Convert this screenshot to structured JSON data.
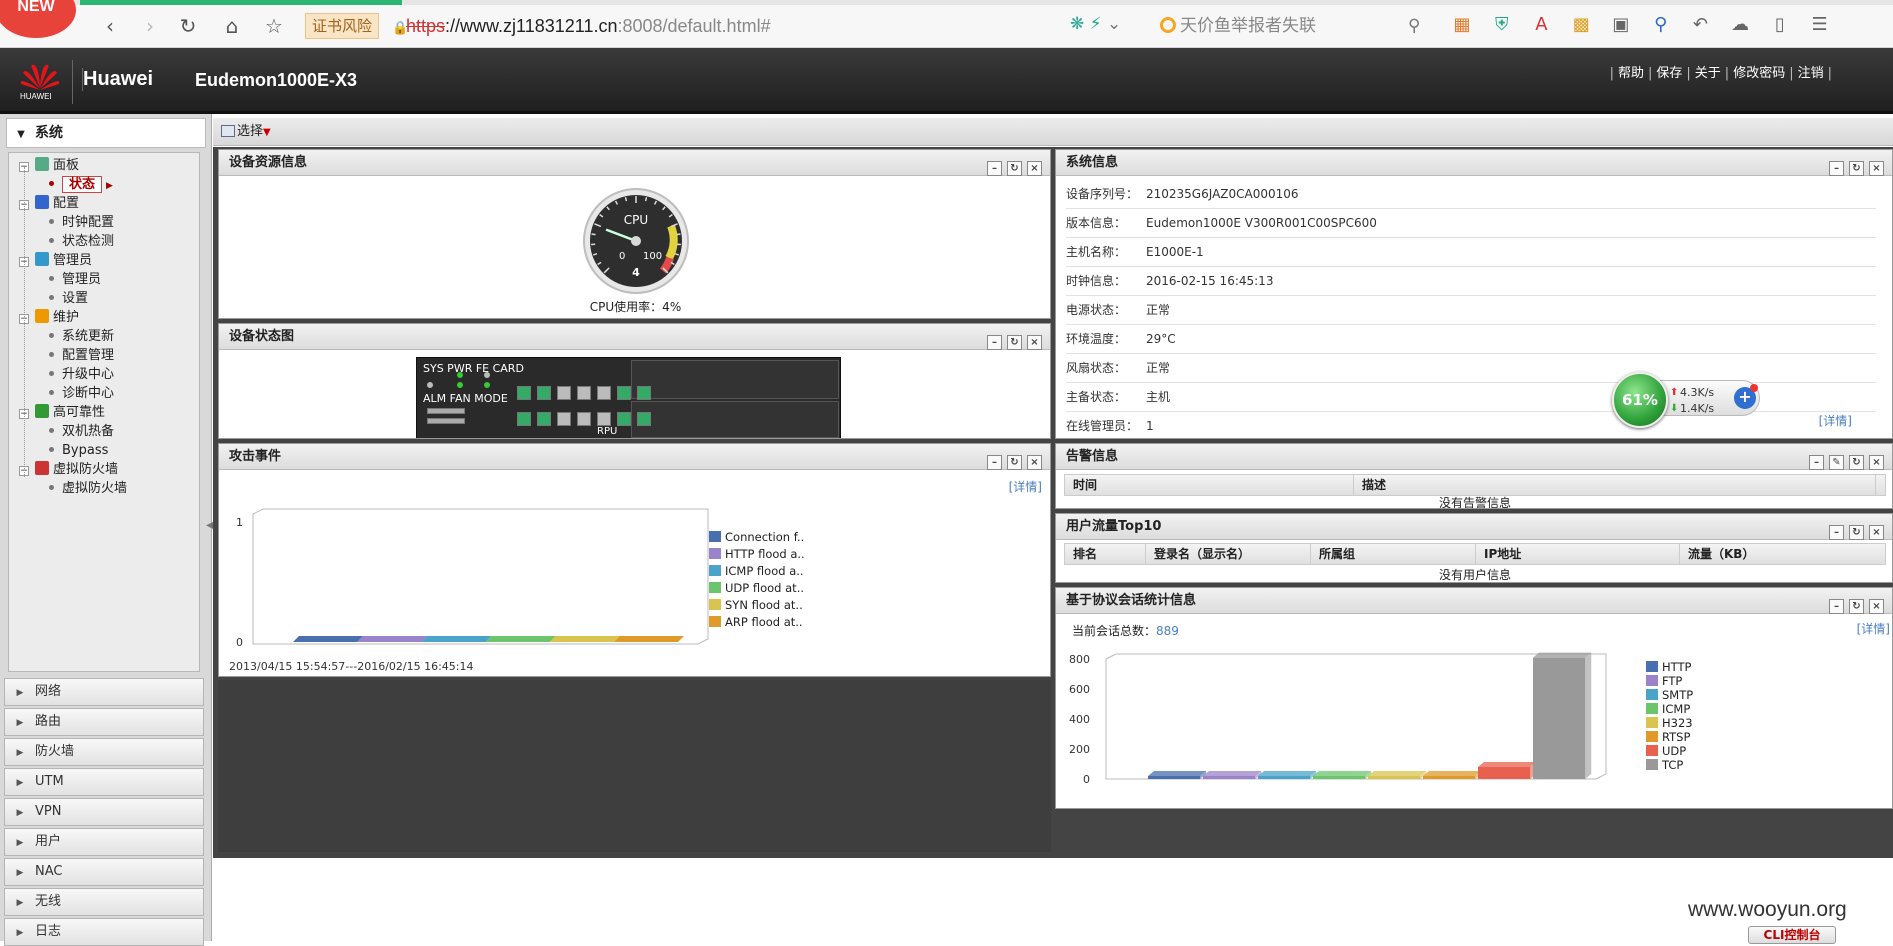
{
  "browser": {
    "new_badge": "NEW",
    "cert_warning": "证书风险",
    "url_proto": "https",
    "url_host": "://www.zj11831211.cn",
    "url_rest": ":8008/default.html#",
    "search_text": "天价鱼举报者失联",
    "load_progress_percent": 17
  },
  "header": {
    "logo_text": "HUAWEI",
    "brand": "Huawei",
    "product": "Eudemon1000E-X3",
    "links": [
      "帮助",
      "保存",
      "关于",
      "修改密码",
      "注销"
    ]
  },
  "sidebar": {
    "top_label": "系统",
    "tree": [
      {
        "label": "面板",
        "level": 0,
        "icon": "dashboard-icon"
      },
      {
        "label": "状态",
        "level": 1,
        "selected": true
      },
      {
        "label": "配置",
        "level": 0,
        "icon": "gear-icon"
      },
      {
        "label": "时钟配置",
        "level": 1
      },
      {
        "label": "状态检测",
        "level": 1
      },
      {
        "label": "管理员",
        "level": 0,
        "icon": "admin-icon"
      },
      {
        "label": "管理员",
        "level": 1
      },
      {
        "label": "设置",
        "level": 1
      },
      {
        "label": "维护",
        "level": 0,
        "icon": "maintenance-icon"
      },
      {
        "label": "系统更新",
        "level": 1
      },
      {
        "label": "配置管理",
        "level": 1
      },
      {
        "label": "升级中心",
        "level": 1
      },
      {
        "label": "诊断中心",
        "level": 1
      },
      {
        "label": "高可靠性",
        "level": 0,
        "icon": "reliability-icon"
      },
      {
        "label": "双机热备",
        "level": 1
      },
      {
        "label": "Bypass",
        "level": 1
      },
      {
        "label": "虚拟防火墙",
        "level": 0,
        "icon": "firewall-icon"
      },
      {
        "label": "虚拟防火墙",
        "level": 1
      }
    ],
    "menu": [
      "网络",
      "路由",
      "防火墙",
      "UTM",
      "VPN",
      "用户",
      "NAC",
      "无线",
      "日志"
    ]
  },
  "toolbar": {
    "select_label": "选择"
  },
  "panels": {
    "resource": {
      "title": "设备资源信息",
      "cpu_label": "CPU",
      "gauge_min": "0",
      "gauge_max": "100",
      "gauge_value": "4",
      "cpu_usage_text": "CPU使用率：4%",
      "cpu_percent": 4
    },
    "device_status": {
      "title": "设备状态图",
      "labels_top": "SYS PWR FE CARD",
      "labels_mid": "ALM FAN MODE",
      "rpu_label": "RPU"
    },
    "attack": {
      "title": "攻击事件",
      "detail": "[详情]",
      "time_range": "2013/04/15 15:54:57---2016/02/15 16:45:14"
    },
    "sysinfo": {
      "title": "系统信息",
      "rows": [
        {
          "k": "设备序列号：",
          "v": "210235G6JAZ0CA000106"
        },
        {
          "k": "版本信息：",
          "v": "Eudemon1000E V300R001C00SPC600"
        },
        {
          "k": "主机名称：",
          "v": "E1000E-1"
        },
        {
          "k": "时钟信息：",
          "v": "2016-02-15 16:45:13"
        },
        {
          "k": "电源状态：",
          "v": "正常"
        },
        {
          "k": "环境温度：",
          "v": "29°C"
        },
        {
          "k": "风扇状态：",
          "v": "正常"
        },
        {
          "k": "主备状态：",
          "v": "主机"
        },
        {
          "k": "在线管理员：",
          "v": "1"
        }
      ],
      "detail": "[详情]"
    },
    "alarm": {
      "title": "告警信息",
      "columns": [
        "时间",
        "描述"
      ],
      "empty": "没有告警信息"
    },
    "traffic": {
      "title": "用户流量Top10",
      "columns": [
        "排名",
        "登录名（显示名）",
        "所属组",
        "IP地址",
        "流量（KB）"
      ],
      "empty": "没有用户信息"
    },
    "session": {
      "title": "基于协议会话统计信息",
      "total_label": "当前会话总数：",
      "total_value": "889",
      "detail": "[详情]"
    }
  },
  "net_widget": {
    "percent": "61%",
    "up": "4.3K/s",
    "down": "1.4K/s"
  },
  "footer": {
    "watermark": "www.wooyun.org",
    "cli_button": "CLI控制台"
  },
  "colors": {
    "accent_red": "#cc0000",
    "header_bg": "#2b2b2b",
    "link_blue": "#4a7fc1"
  },
  "chart_data": [
    {
      "type": "area",
      "title": "攻击事件",
      "x": [
        "2013/04/15 15:54:57",
        "2016/02/15 16:45:14"
      ],
      "ylim": [
        0,
        1
      ],
      "yticks": [
        "0",
        "1"
      ],
      "legend_position": "right",
      "series": [
        {
          "name": "Connection f..",
          "values": [
            0,
            0
          ],
          "color": "#4a6fae"
        },
        {
          "name": "HTTP flood a..",
          "values": [
            0,
            0
          ],
          "color": "#9b83c9"
        },
        {
          "name": "ICMP flood a..",
          "values": [
            0,
            0
          ],
          "color": "#4aa3c9"
        },
        {
          "name": "UDP flood at..",
          "values": [
            0,
            0
          ],
          "color": "#6cc46c"
        },
        {
          "name": "SYN flood at..",
          "values": [
            0,
            0
          ],
          "color": "#d9c450"
        },
        {
          "name": "ARP flood at..",
          "values": [
            0,
            0
          ],
          "color": "#e09a2a"
        }
      ]
    },
    {
      "type": "bar",
      "title": "基于协议会话统计信息",
      "categories": [
        "HTTP",
        "FTP",
        "SMTP",
        "ICMP",
        "H323",
        "RTSP",
        "UDP",
        "TCP"
      ],
      "values": [
        0,
        0,
        0,
        0,
        0,
        0,
        80,
        809
      ],
      "colors": [
        "#4a6fae",
        "#9b83c9",
        "#4aa3c9",
        "#6cc46c",
        "#d9c450",
        "#e09a2a",
        "#e8604e",
        "#999999"
      ],
      "ylim": [
        0,
        800
      ],
      "yticks": [
        "800",
        "600",
        "400",
        "200",
        "0"
      ],
      "legend_position": "right"
    }
  ]
}
